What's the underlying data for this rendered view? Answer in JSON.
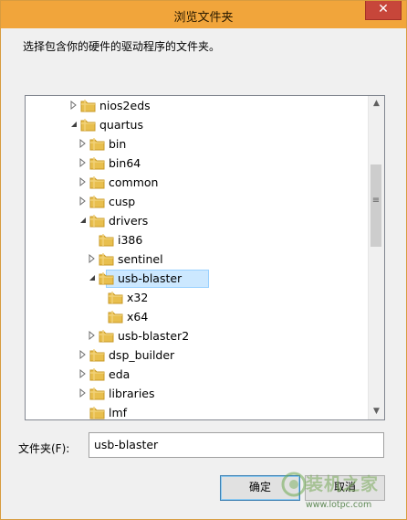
{
  "window": {
    "title": "浏览文件夹",
    "close_glyph": "✕",
    "prompt": "选择包含你的硬件的驱动程序的文件夹。"
  },
  "tree": {
    "nodes": [
      {
        "label": "nios2eds",
        "level": 1,
        "toggle": "collapsed",
        "selected": false
      },
      {
        "label": "quartus",
        "level": 1,
        "toggle": "expanded",
        "selected": false
      },
      {
        "label": "bin",
        "level": 2,
        "toggle": "collapsed",
        "selected": false
      },
      {
        "label": "bin64",
        "level": 2,
        "toggle": "collapsed",
        "selected": false
      },
      {
        "label": "common",
        "level": 2,
        "toggle": "collapsed",
        "selected": false
      },
      {
        "label": "cusp",
        "level": 2,
        "toggle": "collapsed",
        "selected": false
      },
      {
        "label": "drivers",
        "level": 2,
        "toggle": "expanded",
        "selected": false
      },
      {
        "label": "i386",
        "level": 3,
        "toggle": "none",
        "selected": false
      },
      {
        "label": "sentinel",
        "level": 3,
        "toggle": "collapsed",
        "selected": false
      },
      {
        "label": "usb-blaster",
        "level": 3,
        "toggle": "expanded",
        "selected": true
      },
      {
        "label": "x32",
        "level": 4,
        "toggle": "none",
        "selected": false
      },
      {
        "label": "x64",
        "level": 4,
        "toggle": "none",
        "selected": false
      },
      {
        "label": "usb-blaster2",
        "level": 3,
        "toggle": "collapsed",
        "selected": false
      },
      {
        "label": "dsp_builder",
        "level": 2,
        "toggle": "collapsed",
        "selected": false
      },
      {
        "label": "eda",
        "level": 2,
        "toggle": "collapsed",
        "selected": false
      },
      {
        "label": "libraries",
        "level": 2,
        "toggle": "collapsed",
        "selected": false
      },
      {
        "label": "lmf",
        "level": 2,
        "toggle": "none",
        "selected": false
      }
    ]
  },
  "scrollbar": {
    "up_glyph": "▲",
    "down_glyph": "▼",
    "grip_glyph": "≡"
  },
  "folder": {
    "label": "文件夹(F):",
    "value": "usb-blaster"
  },
  "buttons": {
    "ok": "确定",
    "cancel": "取消"
  },
  "watermark": {
    "text": "装机之家",
    "url": "www.lotpc.com"
  },
  "icons": {
    "folder": "folder-icon",
    "expand": "triangle-collapsed-icon",
    "collapse": "triangle-expanded-icon"
  },
  "colors": {
    "titlebar": "#f1a53b",
    "close": "#c7463a",
    "selection": "#cce8ff",
    "folder": "#e8bf4e"
  }
}
